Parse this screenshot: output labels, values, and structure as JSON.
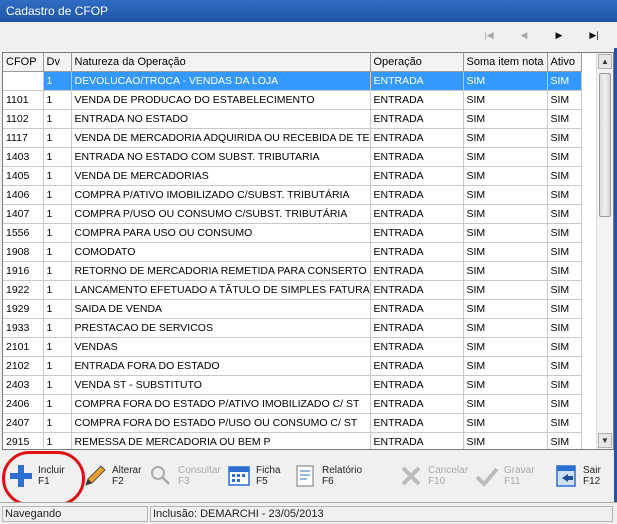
{
  "window": {
    "title": "Cadastro de CFOP"
  },
  "nav": {
    "first": "|◀",
    "prev": "◀",
    "next": "▶",
    "last": "▶|"
  },
  "grid": {
    "columns": [
      "CFOP",
      "Dv",
      "Natureza da Operação",
      "Operação",
      "Soma item nota",
      "Ativo"
    ],
    "rows": [
      [
        "",
        "1",
        "DEVOLUCAO/TROCA - VENDAS DA LOJA",
        "ENTRADA",
        "SIM",
        "SIM"
      ],
      [
        "1101",
        "1",
        "VENDA DE PRODUCAO DO ESTABELECIMENTO",
        "ENTRADA",
        "SIM",
        "SIM"
      ],
      [
        "1102",
        "1",
        "ENTRADA NO ESTADO",
        "ENTRADA",
        "SIM",
        "SIM"
      ],
      [
        "1117",
        "1",
        "VENDA DE MERCADORIA ADQUIRIDA OU RECEBIDA DE TERCE",
        "ENTRADA",
        "SIM",
        "SIM"
      ],
      [
        "1403",
        "1",
        "ENTRADA NO ESTADO COM SUBST. TRIBUTARIA",
        "ENTRADA",
        "SIM",
        "SIM"
      ],
      [
        "1405",
        "1",
        "VENDA DE MERCADORIAS",
        "ENTRADA",
        "SIM",
        "SIM"
      ],
      [
        "1406",
        "1",
        "COMPRA P/ATIVO IMOBILIZADO C/SUBST. TRIBUTÁRIA",
        "ENTRADA",
        "SIM",
        "SIM"
      ],
      [
        "1407",
        "1",
        "COMPRA P/USO OU CONSUMO C/SUBST. TRIBUTÁRIA",
        "ENTRADA",
        "SIM",
        "SIM"
      ],
      [
        "1556",
        "1",
        "COMPRA PARA USO OU CONSUMO",
        "ENTRADA",
        "SIM",
        "SIM"
      ],
      [
        "1908",
        "1",
        "COMODATO",
        "ENTRADA",
        "SIM",
        "SIM"
      ],
      [
        "1916",
        "1",
        "RETORNO DE MERCADORIA REMETIDA PARA CONSERTO OU",
        "ENTRADA",
        "SIM",
        "SIM"
      ],
      [
        "1922",
        "1",
        "LANCAMENTO EFETUADO A TÃ­TULO DE SIMPLES FATURAM",
        "ENTRADA",
        "SIM",
        "SIM"
      ],
      [
        "1929",
        "1",
        "SAIDA DE VENDA",
        "ENTRADA",
        "SIM",
        "SIM"
      ],
      [
        "1933",
        "1",
        "PRESTACAO DE SERVICOS",
        "ENTRADA",
        "SIM",
        "SIM"
      ],
      [
        "2101",
        "1",
        "VENDAS",
        "ENTRADA",
        "SIM",
        "SIM"
      ],
      [
        "2102",
        "1",
        "ENTRADA FORA DO ESTADO",
        "ENTRADA",
        "SIM",
        "SIM"
      ],
      [
        "2403",
        "1",
        "VENDA ST - SUBSTITUTO",
        "ENTRADA",
        "SIM",
        "SIM"
      ],
      [
        "2406",
        "1",
        "COMPRA FORA DO ESTADO P/ATIVO IMOBILIZADO C/ ST",
        "ENTRADA",
        "SIM",
        "SIM"
      ],
      [
        "2407",
        "1",
        "COMPRA FORA DO ESTADO P/USO OU CONSUMO C/ ST",
        "ENTRADA",
        "SIM",
        "SIM"
      ],
      [
        "2915",
        "1",
        "REMESSA DE MERCADORIA OU BEM P",
        "ENTRADA",
        "SIM",
        "SIM"
      ]
    ]
  },
  "toolbar": {
    "incluir": {
      "label": "Incluir",
      "key": "F1"
    },
    "alterar": {
      "label": "Alterar",
      "key": "F2"
    },
    "consultar": {
      "label": "Consultar",
      "key": "F3"
    },
    "ficha": {
      "label": "Ficha",
      "key": "F5"
    },
    "relatorio": {
      "label": "Relatório",
      "key": "F6"
    },
    "cancelar": {
      "label": "Cancelar",
      "key": "F10"
    },
    "gravar": {
      "label": "Gravar",
      "key": "F11"
    },
    "sair": {
      "label": "Sair",
      "key": "F12"
    }
  },
  "status": {
    "mode": "Navegando",
    "info": "Inclusão: DEMARCHI - 23/05/2013"
  },
  "colors": {
    "selection": "#3399ff",
    "titlebar": "#1f55a6",
    "highlight": "#e01010"
  }
}
